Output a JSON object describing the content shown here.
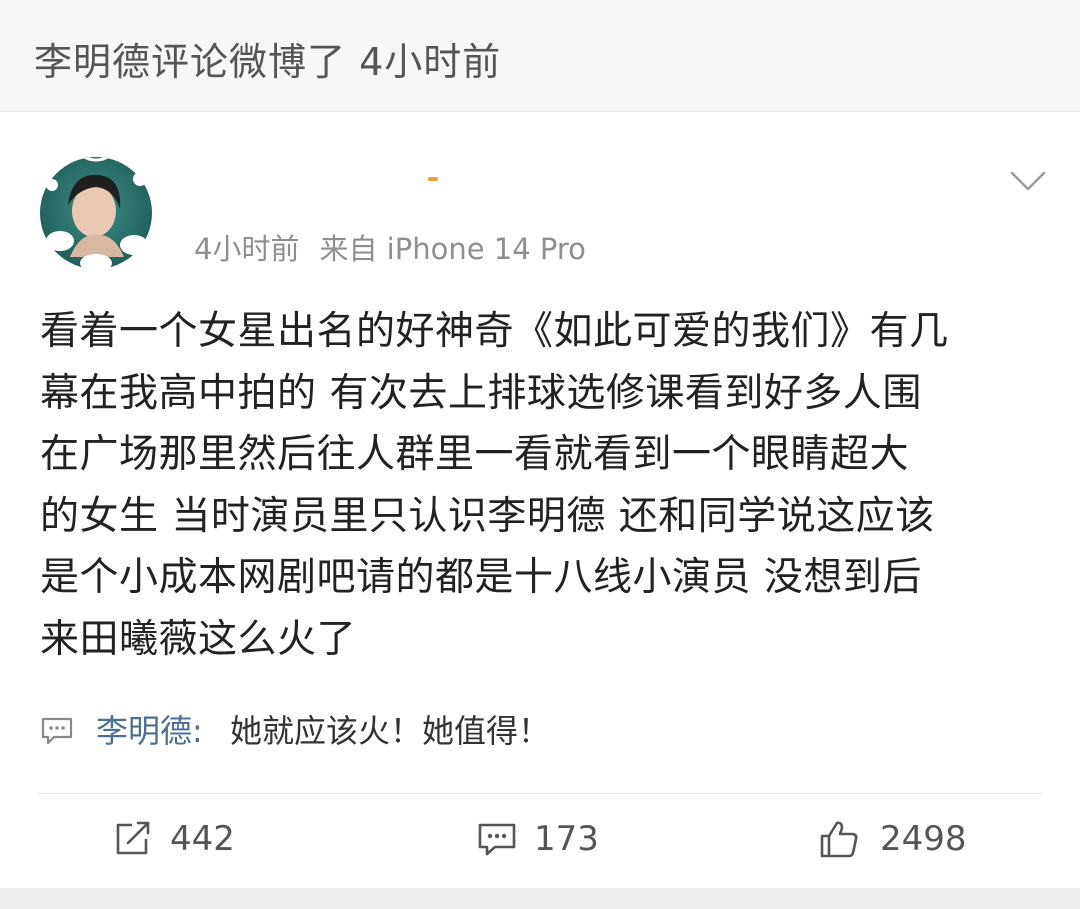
{
  "header": {
    "activity_text": "李明德评论微博了 4小时前"
  },
  "post": {
    "time": "4小时前",
    "source": "来自 iPhone 14 Pro",
    "body_lines": [
      "看着一个女星出名的好神奇《如此可爱的我们》有几",
      "幕在我高中拍的 有次去上排球选修课看到好多人围",
      "在广场那里然后往人群里一看就看到一个眼睛超大",
      "的女生 当时演员里只认识李明德 还和同学说这应该",
      "是个小成本网剧吧请的都是十八线小演员  没想到后",
      "来田曦薇这么火了"
    ]
  },
  "reply": {
    "author": "李明德:",
    "text": "她就应该火！她值得！"
  },
  "actions": {
    "repost_count": "442",
    "comment_count": "173",
    "like_count": "2498"
  },
  "icons": {
    "more": "chevron-down-icon",
    "reply": "comment-bubble-icon",
    "repost": "repost-icon",
    "comment": "comment-icon",
    "like": "thumbs-up-icon"
  },
  "colors": {
    "reply_author": "#4c6f98",
    "meta_text": "#8f8f8f",
    "top_bar_bg": "#f7f7f7"
  }
}
